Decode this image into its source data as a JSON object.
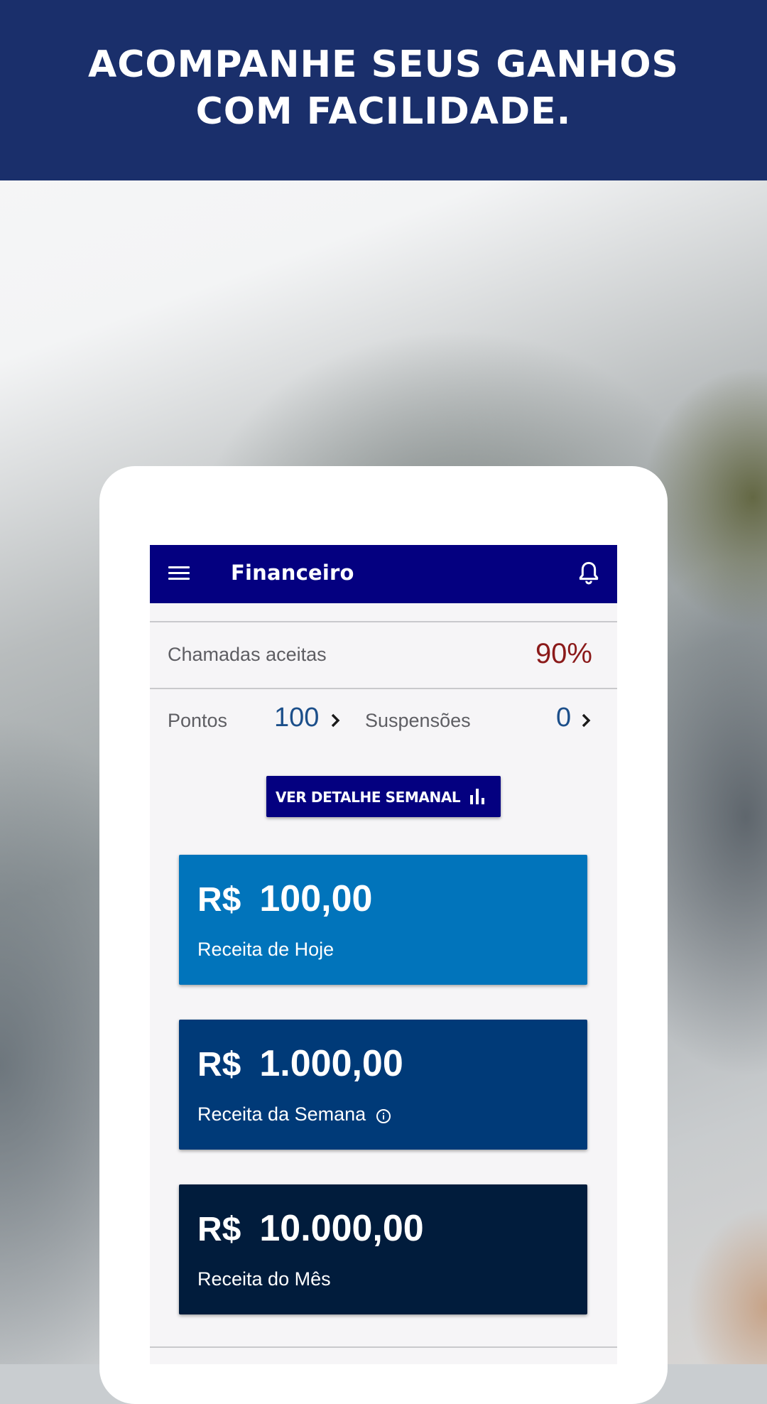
{
  "banner": {
    "title": "ACOMPANHE SEUS GANHOS\nCOM FACILIDADE."
  },
  "appbar": {
    "title": "Financeiro"
  },
  "acceptance": {
    "label": "Chamadas aceitas",
    "value": "90%"
  },
  "stats": {
    "points_label": "Pontos",
    "points_value": "100",
    "suspensions_label": "Suspensões",
    "suspensions_value": "0"
  },
  "weekly_button": {
    "label": "VER DETALHE SEMANAL"
  },
  "cards": [
    {
      "currency": "R$",
      "amount": "100,00",
      "label": "Receita de Hoje",
      "color": "#0174bb"
    },
    {
      "currency": "R$",
      "amount": "1.000,00",
      "label": "Receita da Semana",
      "color": "#003a78"
    },
    {
      "currency": "R$",
      "amount": "10.000,00",
      "label": "Receita do Mês",
      "color": "#011c3c"
    }
  ],
  "colors": {
    "banner": "#1a2f6b",
    "appbar": "#040080",
    "accent_red": "#8b1a1a",
    "stat_blue": "#1c4f8a"
  },
  "icons": [
    "hamburger-menu-icon",
    "bell-icon",
    "chevron-right-icon",
    "bar-chart-icon",
    "info-icon"
  ]
}
